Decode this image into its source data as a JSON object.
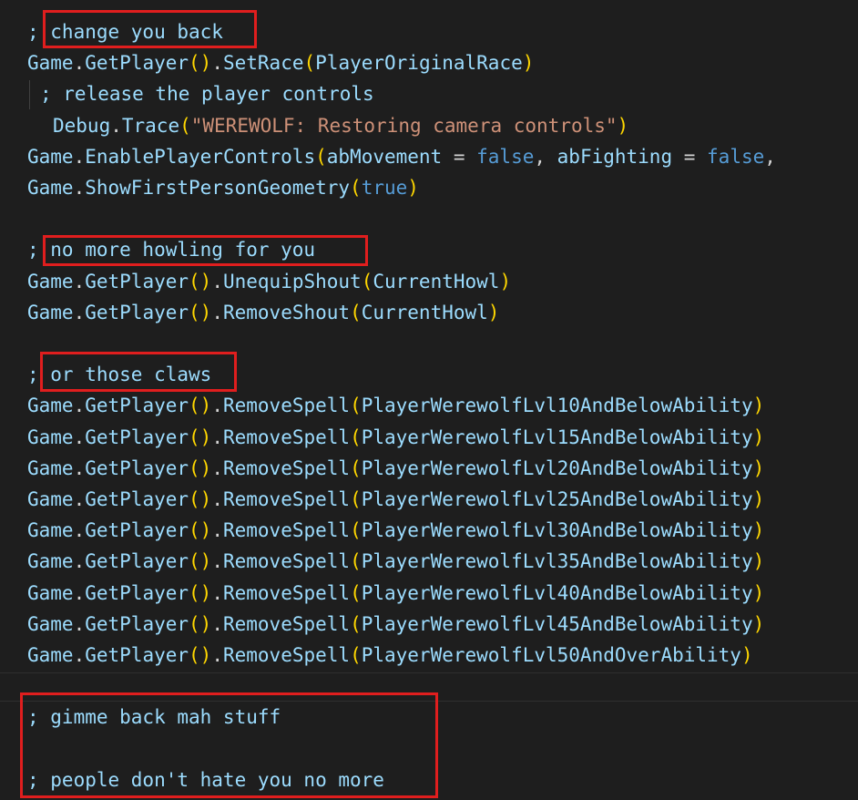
{
  "editor": {
    "lines": [
      {
        "indent": 0,
        "tokens": [
          {
            "t": "; change you back",
            "c": "comment"
          }
        ]
      },
      {
        "indent": 0,
        "tokens": [
          {
            "t": "Game",
            "c": "id"
          },
          {
            "t": ".",
            "c": "punct"
          },
          {
            "t": "GetPlayer",
            "c": "id"
          },
          {
            "t": "()",
            "c": "paren"
          },
          {
            "t": ".",
            "c": "punct"
          },
          {
            "t": "SetRace",
            "c": "id"
          },
          {
            "t": "(",
            "c": "paren"
          },
          {
            "t": "PlayerOriginalRace",
            "c": "id"
          },
          {
            "t": ")",
            "c": "paren"
          }
        ]
      },
      {
        "indent": 1,
        "tokens": [
          {
            "t": "; release the player controls",
            "c": "comment"
          }
        ]
      },
      {
        "indent": 2,
        "tokens": [
          {
            "t": "Debug",
            "c": "id"
          },
          {
            "t": ".",
            "c": "punct"
          },
          {
            "t": "Trace",
            "c": "id"
          },
          {
            "t": "(",
            "c": "paren"
          },
          {
            "t": "\"WEREWOLF: Restoring camera controls\"",
            "c": "str"
          },
          {
            "t": ")",
            "c": "paren"
          }
        ]
      },
      {
        "indent": 0,
        "tokens": [
          {
            "t": "Game",
            "c": "id"
          },
          {
            "t": ".",
            "c": "punct"
          },
          {
            "t": "EnablePlayerControls",
            "c": "id"
          },
          {
            "t": "(",
            "c": "paren"
          },
          {
            "t": "abMovement",
            "c": "id"
          },
          {
            "t": " = ",
            "c": "op"
          },
          {
            "t": "false",
            "c": "kw"
          },
          {
            "t": ", ",
            "c": "punct"
          },
          {
            "t": "abFighting",
            "c": "id"
          },
          {
            "t": " = ",
            "c": "op"
          },
          {
            "t": "false",
            "c": "kw"
          },
          {
            "t": ",",
            "c": "punct"
          }
        ]
      },
      {
        "indent": 0,
        "tokens": [
          {
            "t": "Game",
            "c": "id"
          },
          {
            "t": ".",
            "c": "punct"
          },
          {
            "t": "ShowFirstPersonGeometry",
            "c": "id"
          },
          {
            "t": "(",
            "c": "paren"
          },
          {
            "t": "true",
            "c": "kw"
          },
          {
            "t": ")",
            "c": "paren"
          }
        ]
      },
      {
        "indent": 0,
        "tokens": []
      },
      {
        "indent": 0,
        "tokens": [
          {
            "t": "; no more howling for you",
            "c": "comment"
          }
        ]
      },
      {
        "indent": 0,
        "tokens": [
          {
            "t": "Game",
            "c": "id"
          },
          {
            "t": ".",
            "c": "punct"
          },
          {
            "t": "GetPlayer",
            "c": "id"
          },
          {
            "t": "()",
            "c": "paren"
          },
          {
            "t": ".",
            "c": "punct"
          },
          {
            "t": "UnequipShout",
            "c": "id"
          },
          {
            "t": "(",
            "c": "paren"
          },
          {
            "t": "CurrentHowl",
            "c": "id"
          },
          {
            "t": ")",
            "c": "paren"
          }
        ]
      },
      {
        "indent": 0,
        "tokens": [
          {
            "t": "Game",
            "c": "id"
          },
          {
            "t": ".",
            "c": "punct"
          },
          {
            "t": "GetPlayer",
            "c": "id"
          },
          {
            "t": "()",
            "c": "paren"
          },
          {
            "t": ".",
            "c": "punct"
          },
          {
            "t": "RemoveShout",
            "c": "id"
          },
          {
            "t": "(",
            "c": "paren"
          },
          {
            "t": "CurrentHowl",
            "c": "id"
          },
          {
            "t": ")",
            "c": "paren"
          }
        ]
      },
      {
        "indent": 0,
        "tokens": []
      },
      {
        "indent": 0,
        "tokens": [
          {
            "t": "; or those claws",
            "c": "comment"
          }
        ]
      },
      {
        "indent": 0,
        "tokens": [
          {
            "t": "Game",
            "c": "id"
          },
          {
            "t": ".",
            "c": "punct"
          },
          {
            "t": "GetPlayer",
            "c": "id"
          },
          {
            "t": "()",
            "c": "paren"
          },
          {
            "t": ".",
            "c": "punct"
          },
          {
            "t": "RemoveSpell",
            "c": "id"
          },
          {
            "t": "(",
            "c": "paren"
          },
          {
            "t": "PlayerWerewolfLvl10AndBelowAbility",
            "c": "id"
          },
          {
            "t": ")",
            "c": "paren"
          }
        ]
      },
      {
        "indent": 0,
        "tokens": [
          {
            "t": "Game",
            "c": "id"
          },
          {
            "t": ".",
            "c": "punct"
          },
          {
            "t": "GetPlayer",
            "c": "id"
          },
          {
            "t": "()",
            "c": "paren"
          },
          {
            "t": ".",
            "c": "punct"
          },
          {
            "t": "RemoveSpell",
            "c": "id"
          },
          {
            "t": "(",
            "c": "paren"
          },
          {
            "t": "PlayerWerewolfLvl15AndBelowAbility",
            "c": "id"
          },
          {
            "t": ")",
            "c": "paren"
          }
        ]
      },
      {
        "indent": 0,
        "tokens": [
          {
            "t": "Game",
            "c": "id"
          },
          {
            "t": ".",
            "c": "punct"
          },
          {
            "t": "GetPlayer",
            "c": "id"
          },
          {
            "t": "()",
            "c": "paren"
          },
          {
            "t": ".",
            "c": "punct"
          },
          {
            "t": "RemoveSpell",
            "c": "id"
          },
          {
            "t": "(",
            "c": "paren"
          },
          {
            "t": "PlayerWerewolfLvl20AndBelowAbility",
            "c": "id"
          },
          {
            "t": ")",
            "c": "paren"
          }
        ]
      },
      {
        "indent": 0,
        "tokens": [
          {
            "t": "Game",
            "c": "id"
          },
          {
            "t": ".",
            "c": "punct"
          },
          {
            "t": "GetPlayer",
            "c": "id"
          },
          {
            "t": "()",
            "c": "paren"
          },
          {
            "t": ".",
            "c": "punct"
          },
          {
            "t": "RemoveSpell",
            "c": "id"
          },
          {
            "t": "(",
            "c": "paren"
          },
          {
            "t": "PlayerWerewolfLvl25AndBelowAbility",
            "c": "id"
          },
          {
            "t": ")",
            "c": "paren"
          }
        ]
      },
      {
        "indent": 0,
        "tokens": [
          {
            "t": "Game",
            "c": "id"
          },
          {
            "t": ".",
            "c": "punct"
          },
          {
            "t": "GetPlayer",
            "c": "id"
          },
          {
            "t": "()",
            "c": "paren"
          },
          {
            "t": ".",
            "c": "punct"
          },
          {
            "t": "RemoveSpell",
            "c": "id"
          },
          {
            "t": "(",
            "c": "paren"
          },
          {
            "t": "PlayerWerewolfLvl30AndBelowAbility",
            "c": "id"
          },
          {
            "t": ")",
            "c": "paren"
          }
        ]
      },
      {
        "indent": 0,
        "tokens": [
          {
            "t": "Game",
            "c": "id"
          },
          {
            "t": ".",
            "c": "punct"
          },
          {
            "t": "GetPlayer",
            "c": "id"
          },
          {
            "t": "()",
            "c": "paren"
          },
          {
            "t": ".",
            "c": "punct"
          },
          {
            "t": "RemoveSpell",
            "c": "id"
          },
          {
            "t": "(",
            "c": "paren"
          },
          {
            "t": "PlayerWerewolfLvl35AndBelowAbility",
            "c": "id"
          },
          {
            "t": ")",
            "c": "paren"
          }
        ]
      },
      {
        "indent": 0,
        "tokens": [
          {
            "t": "Game",
            "c": "id"
          },
          {
            "t": ".",
            "c": "punct"
          },
          {
            "t": "GetPlayer",
            "c": "id"
          },
          {
            "t": "()",
            "c": "paren"
          },
          {
            "t": ".",
            "c": "punct"
          },
          {
            "t": "RemoveSpell",
            "c": "id"
          },
          {
            "t": "(",
            "c": "paren"
          },
          {
            "t": "PlayerWerewolfLvl40AndBelowAbility",
            "c": "id"
          },
          {
            "t": ")",
            "c": "paren"
          }
        ]
      },
      {
        "indent": 0,
        "tokens": [
          {
            "t": "Game",
            "c": "id"
          },
          {
            "t": ".",
            "c": "punct"
          },
          {
            "t": "GetPlayer",
            "c": "id"
          },
          {
            "t": "()",
            "c": "paren"
          },
          {
            "t": ".",
            "c": "punct"
          },
          {
            "t": "RemoveSpell",
            "c": "id"
          },
          {
            "t": "(",
            "c": "paren"
          },
          {
            "t": "PlayerWerewolfLvl45AndBelowAbility",
            "c": "id"
          },
          {
            "t": ")",
            "c": "paren"
          }
        ]
      },
      {
        "indent": 0,
        "tokens": [
          {
            "t": "Game",
            "c": "id"
          },
          {
            "t": ".",
            "c": "punct"
          },
          {
            "t": "GetPlayer",
            "c": "id"
          },
          {
            "t": "()",
            "c": "paren"
          },
          {
            "t": ".",
            "c": "punct"
          },
          {
            "t": "RemoveSpell",
            "c": "id"
          },
          {
            "t": "(",
            "c": "paren"
          },
          {
            "t": "PlayerWerewolfLvl50AndOverAbility",
            "c": "id"
          },
          {
            "t": ")",
            "c": "paren"
          }
        ]
      },
      {
        "indent": 0,
        "tokens": []
      },
      {
        "indent": 0,
        "tokens": [
          {
            "t": "; gimme back mah stuff",
            "c": "comment"
          }
        ]
      },
      {
        "indent": 0,
        "tokens": []
      },
      {
        "indent": 0,
        "tokens": [
          {
            "t": "; people don't hate you no more",
            "c": "comment"
          }
        ]
      }
    ]
  },
  "colors": {
    "background": "#1e1e1e",
    "identifier": "#9cdcfe",
    "paren": "#ffd700",
    "string": "#ce9178",
    "keyword": "#569cd6",
    "annotation_box": "#e01e1e"
  }
}
